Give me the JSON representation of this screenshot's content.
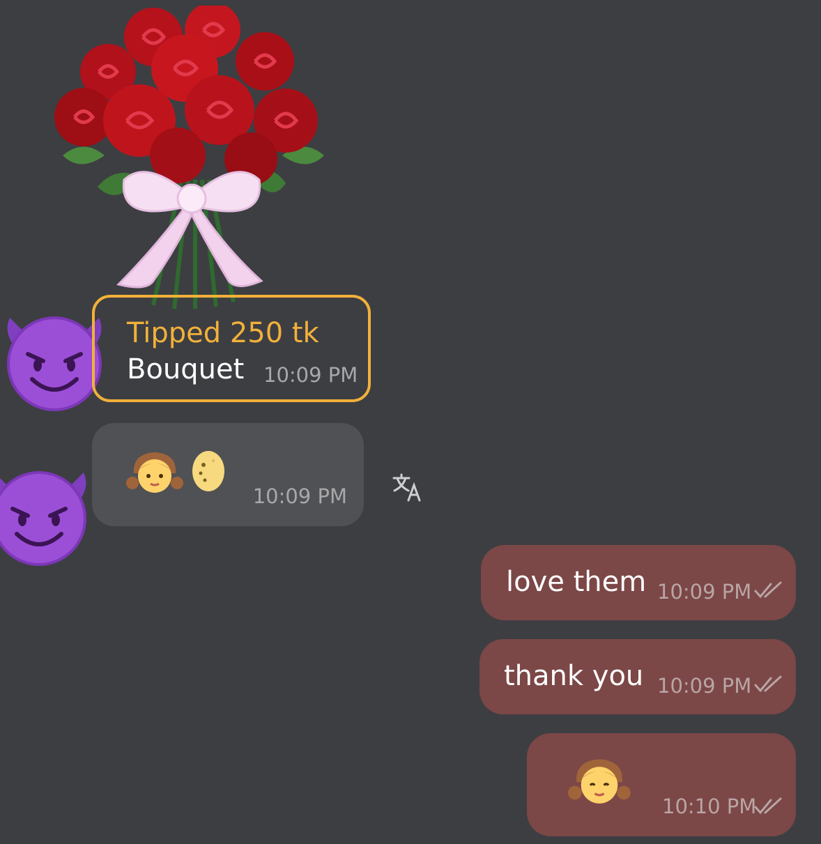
{
  "messages": {
    "gift": {
      "title": "Tipped 250 tk",
      "name": "Bouquet",
      "time": "10:09 PM"
    },
    "incoming": {
      "time": "10:09 PM"
    },
    "outgoing": [
      {
        "text": "love them",
        "time": "10:09 PM"
      },
      {
        "text": "thank you",
        "time": "10:09 PM"
      },
      {
        "text": "",
        "time": "10:10 PM"
      }
    ]
  },
  "colors": {
    "background": "#3d3e42",
    "gift_accent": "#f2b13a",
    "incoming_bubble": "#505154",
    "outgoing_bubble": "#7c4747"
  },
  "icons": [
    "bouquet-icon",
    "smiling-devil-avatar-icon",
    "girl-emoji-icon",
    "moon-face-emoji-icon",
    "translate-icon",
    "double-check-icon"
  ]
}
